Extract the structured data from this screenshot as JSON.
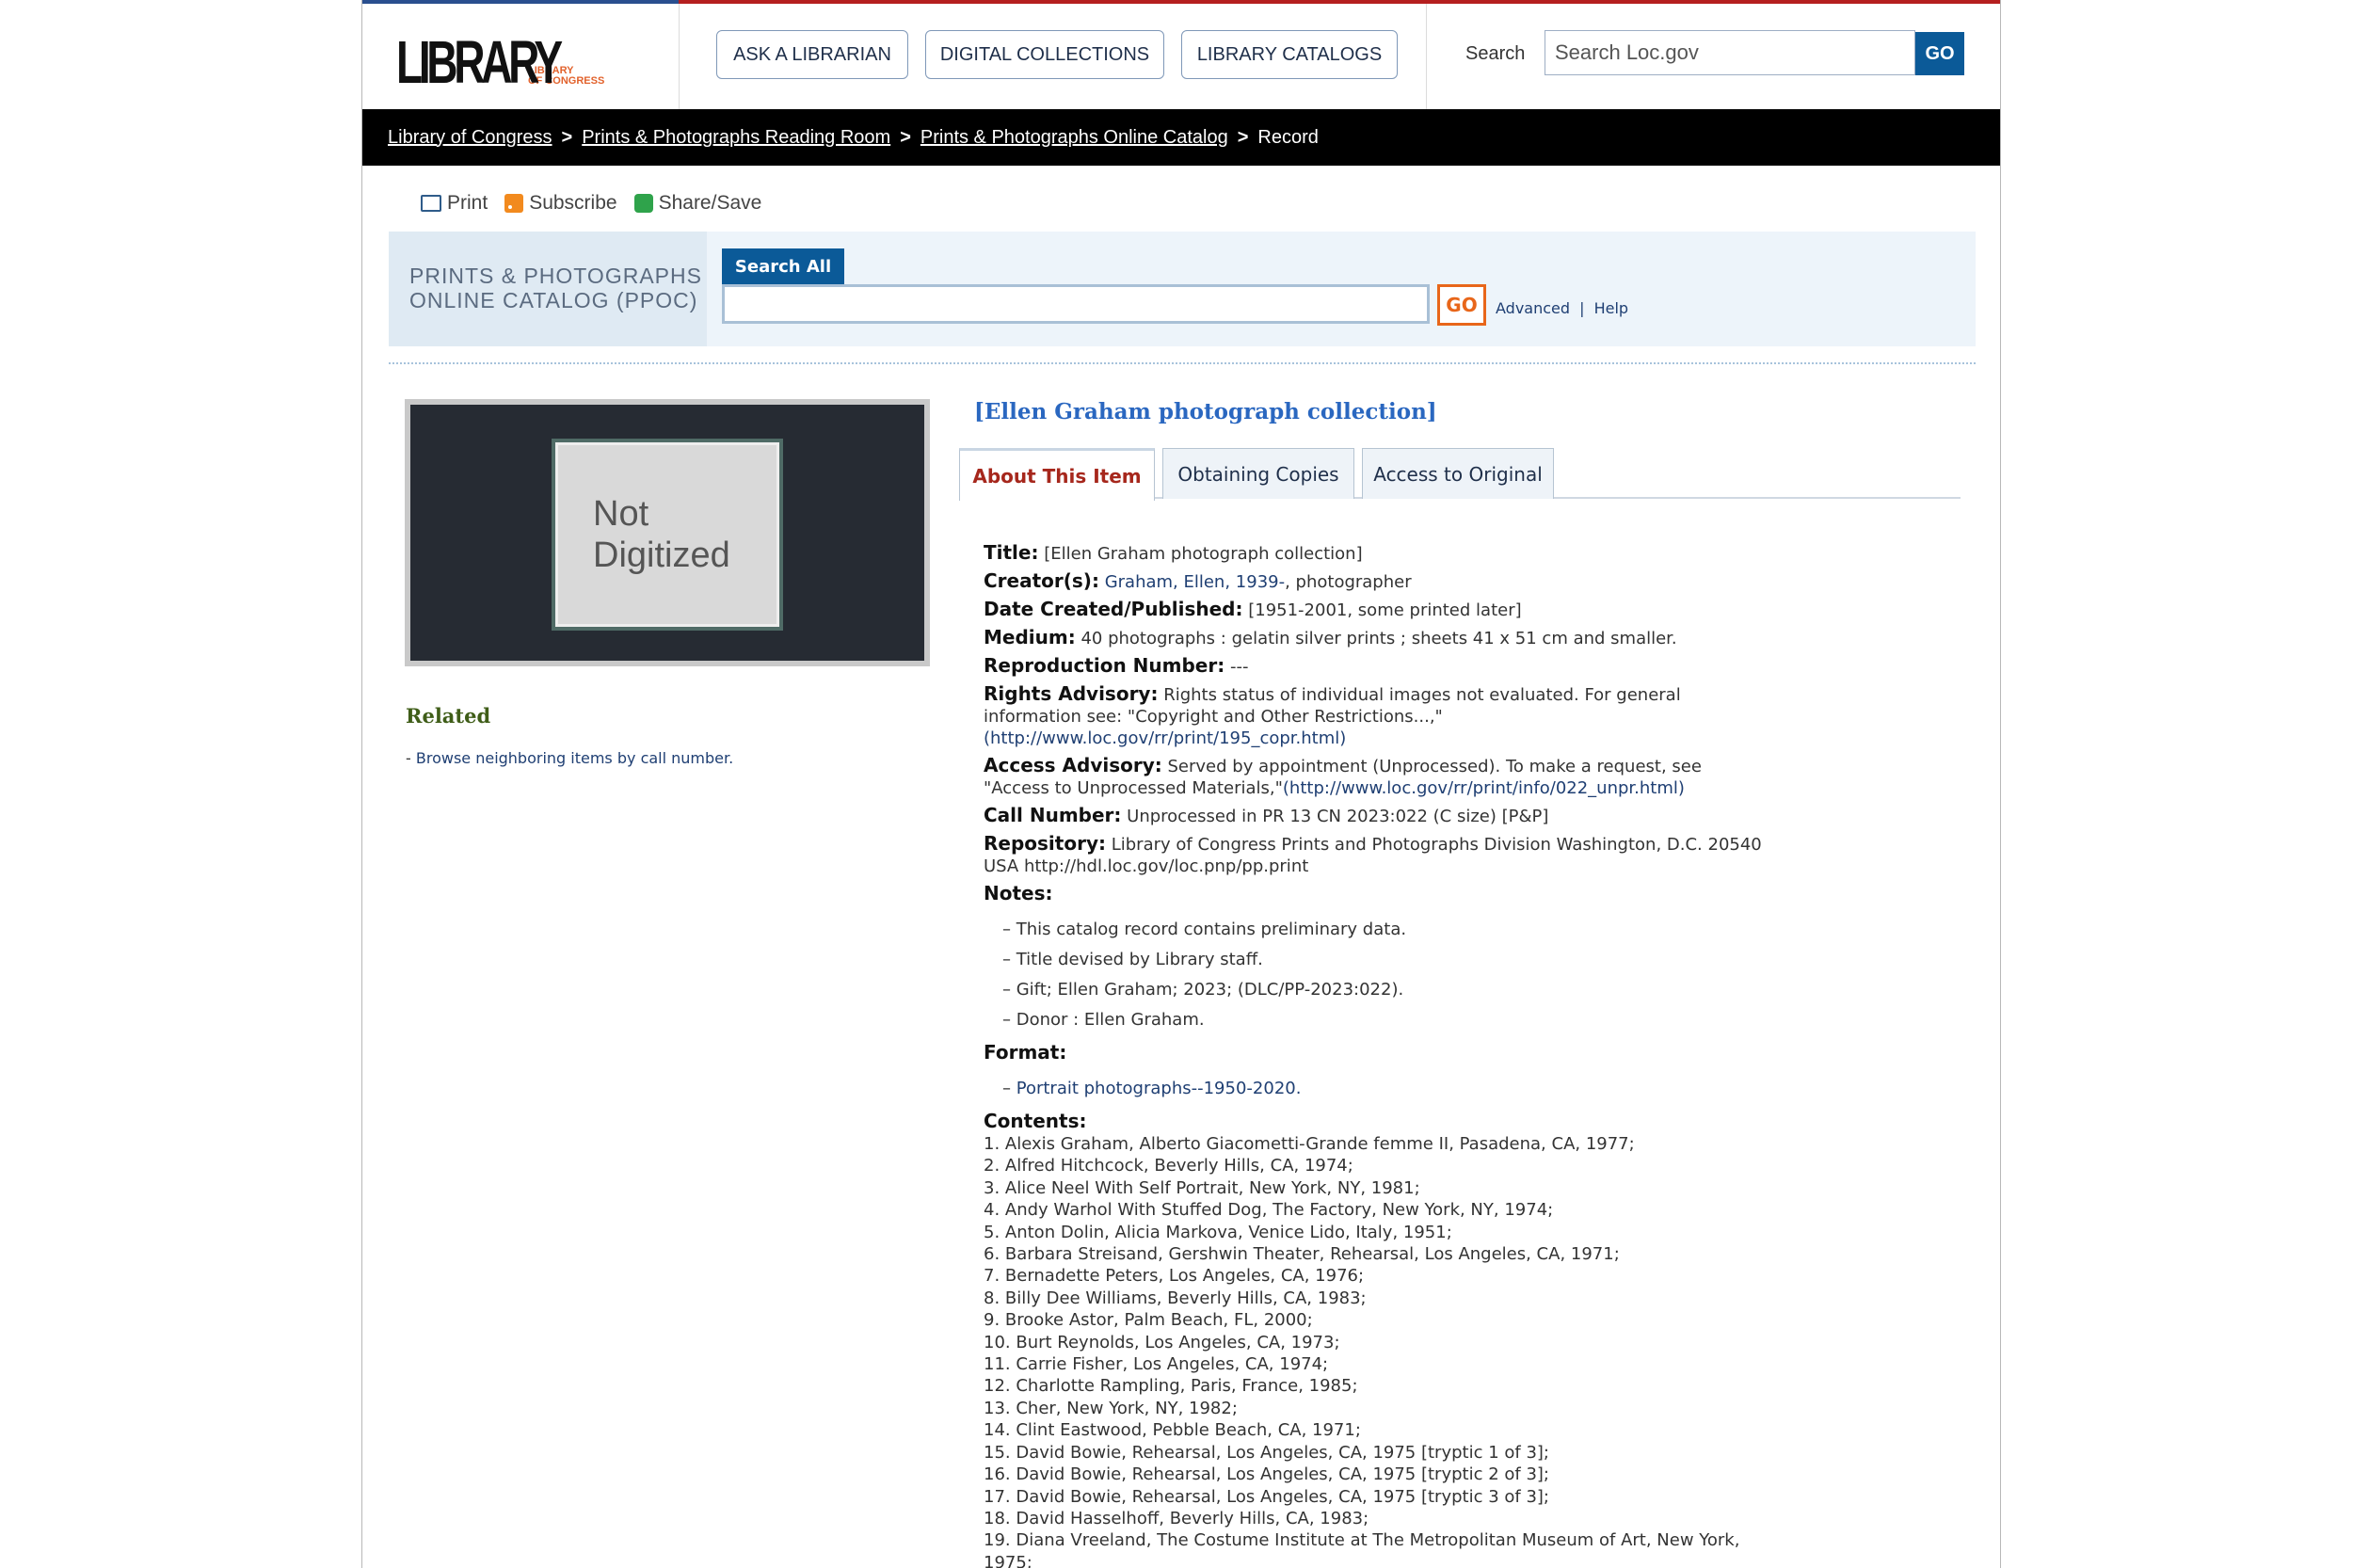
{
  "header": {
    "logo_main": "LIBRARY",
    "logo_sub_1": "LIBRARY",
    "logo_sub_2": "OF CONGRESS",
    "buttons": [
      "ASK A LIBRARIAN",
      "DIGITAL COLLECTIONS",
      "LIBRARY CATALOGS"
    ],
    "search_label": "Search",
    "search_placeholder": "Search Loc.gov",
    "search_go": "GO"
  },
  "breadcrumb": {
    "items": [
      "Library of Congress",
      "Prints & Photographs Reading Room",
      "Prints & Photographs Online Catalog"
    ],
    "current": "Record",
    "separator": ">"
  },
  "tools": {
    "print": "Print",
    "subscribe": "Subscribe",
    "share": "Share/Save"
  },
  "ppoc": {
    "label_1": "PRINTS & PHOTOGRAPHS",
    "label_2": "ONLINE CATALOG (PPOC)",
    "tab": "Search All",
    "input_value": "",
    "go": "GO",
    "advanced": "Advanced",
    "sep": "|",
    "help": "Help"
  },
  "thumbnail": {
    "line1": "Not",
    "line2": "Digitized"
  },
  "related": {
    "heading": "Related",
    "prefix": "- ",
    "link": "Browse neighboring items by call number."
  },
  "item": {
    "title": "[Ellen Graham photograph collection]",
    "tabs": [
      "About This Item",
      "Obtaining Copies",
      "Access to Original"
    ]
  },
  "record": {
    "title_label": "Title:",
    "title_value": "[Ellen Graham photograph collection]",
    "creator_label": "Creator(s):",
    "creator_link": "Graham, Ellen, 1939-",
    "creator_suffix": ", photographer",
    "date_label": "Date Created/Published:",
    "date_value": "[1951-2001, some printed later]",
    "medium_label": "Medium:",
    "medium_value": "40 photographs : gelatin silver prints ; sheets 41 x 51 cm and smaller.",
    "repro_label": "Reproduction Number:",
    "repro_value": "---",
    "rights_label": "Rights Advisory:",
    "rights_value": "Rights status of individual images not evaluated. For general information see: \"Copyright and Other Restrictions...,\"",
    "rights_link": "(http://www.loc.gov/rr/print/195_copr.html)",
    "access_label": "Access Advisory:",
    "access_value": "Served by appointment (Unprocessed). To make a request, see \"Access to Unprocessed Materials,\"",
    "access_link": "(http://www.loc.gov/rr/print/info/022_unpr.html)",
    "call_label": "Call Number:",
    "call_value": "Unprocessed in PR 13 CN 2023:022 (C size) [P&P]",
    "repo_label": "Repository:",
    "repo_value": "Library of Congress Prints and Photographs Division Washington, D.C. 20540 USA http://hdl.loc.gov/loc.pnp/pp.print",
    "notes_label": "Notes:",
    "notes": [
      "This catalog record contains preliminary data.",
      "Title devised by Library staff.",
      "Gift; Ellen Graham; 2023; (DLC/PP-2023:022).",
      "Donor : Ellen Graham."
    ],
    "format_label": "Format:",
    "format_link": "Portrait photographs--1950-2020.",
    "contents_label": "Contents:",
    "contents": [
      "1. Alexis Graham, Alberto Giacometti-Grande femme II, Pasadena, CA, 1977;",
      "2. Alfred Hitchcock, Beverly Hills, CA, 1974;",
      "3. Alice Neel With Self Portrait, New York, NY, 1981;",
      "4. Andy Warhol With Stuffed Dog, The Factory, New York, NY, 1974;",
      "5. Anton Dolin, Alicia Markova, Venice Lido, Italy, 1951;",
      "6. Barbara Streisand, Gershwin Theater, Rehearsal, Los Angeles, CA, 1971;",
      "7. Bernadette Peters, Los Angeles, CA, 1976;",
      "8. Billy Dee Williams, Beverly Hills, CA, 1983;",
      "9. Brooke Astor, Palm Beach, FL, 2000;",
      "10. Burt Reynolds, Los Angeles, CA, 1973;",
      "11. Carrie Fisher, Los Angeles, CA, 1974;",
      "12. Charlotte Rampling, Paris, France, 1985;",
      "13. Cher, New York, NY, 1982;",
      "14. Clint Eastwood, Pebble Beach, CA, 1971;",
      "15. David Bowie, Rehearsal, Los Angeles, CA, 1975 [tryptic 1 of 3];",
      "16. David Bowie, Rehearsal, Los Angeles, CA, 1975 [tryptic 2 of 3];",
      "17. David Bowie, Rehearsal, Los Angeles, CA, 1975 [tryptic 3 of 3];",
      "18. David Hasselhoff, Beverly Hills, CA, 1983;",
      "19. Diana Vreeland, The Costume Institute at The Metropolitan Museum of Art, New York, 1975;"
    ]
  }
}
